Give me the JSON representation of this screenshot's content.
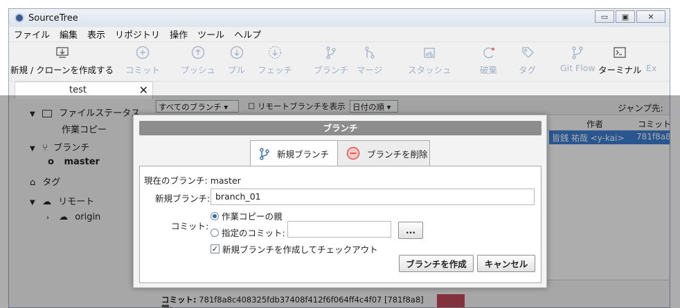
{
  "window": {
    "title": "SourceTree",
    "controls": [
      "▭",
      "▣",
      "✕"
    ]
  },
  "menu": [
    "ファイル",
    "編集",
    "表示",
    "リポジトリ",
    "操作",
    "ツール",
    "ヘルプ"
  ],
  "toolbar": {
    "items": [
      {
        "label": "新規 / クローンを作成する",
        "icon": "computer-download-icon",
        "enabled": true
      },
      {
        "label": "コミット",
        "icon": "plus-circle-icon",
        "enabled": false
      },
      {
        "label": "プッシュ",
        "icon": "arrow-up-circle-icon",
        "enabled": false
      },
      {
        "label": "プル",
        "icon": "arrow-down-circle-icon",
        "enabled": false
      },
      {
        "label": "フェッチ",
        "icon": "arrow-down-dashed-circle-icon",
        "enabled": false
      },
      {
        "label": "ブランチ",
        "icon": "branch-icon",
        "enabled": false
      },
      {
        "label": "マージ",
        "icon": "merge-icon",
        "enabled": false
      },
      {
        "label": "スタッシュ",
        "icon": "stash-icon",
        "enabled": false
      },
      {
        "label": "破棄",
        "icon": "discard-icon",
        "enabled": false
      },
      {
        "label": "タグ",
        "icon": "tag-icon",
        "enabled": false
      },
      {
        "label": "Git Flow",
        "icon": "git-flow-icon",
        "enabled": false
      },
      {
        "label": "ターミナル",
        "icon": "terminal-icon",
        "enabled": true
      },
      {
        "label": "Ex",
        "icon": "",
        "enabled": false
      }
    ]
  },
  "tab": {
    "label": "test",
    "close": "✕"
  },
  "sidebar": {
    "file_status": "ファイルステータス",
    "working_copy": "作業コピー",
    "branches": "ブランチ",
    "branch_master": "master",
    "tags": "タグ",
    "remotes": "リモート",
    "remote_origin": "origin"
  },
  "log_controls": {
    "branch_filter": "すべてのブランチ ▾",
    "show_remote": "リモートブランチを表示",
    "sort": "日付の順 ▾",
    "jump": "ジャンプ先:"
  },
  "columns": {
    "author": "作者",
    "commit": "コミット"
  },
  "selected_row": {
    "author": "皆銭 祐哉 <y-kai>",
    "commit": "781f8a8"
  },
  "details": {
    "commit_label": "コミット:",
    "commit_value": "781f8a8c408325fdb37408f412f6f064ff4c4f07 [781f8a8]",
    "parent_label": "親:"
  },
  "dialog": {
    "title": "ブランチ",
    "tab_new": "新規ブランチ",
    "tab_delete": "ブランチを削除",
    "current_branch_label": "現在のブランチ:",
    "current_branch_value": "master",
    "new_branch_label": "新規ブランチ:",
    "new_branch_value": "branch_01",
    "commit_label": "コミット:",
    "radio_parent": "作業コピーの親",
    "radio_specified": "指定のコミット:",
    "specified_commit_value": "",
    "browse_button": "...",
    "checkout_label": "新規ブランチを作成してチェックアウト",
    "checkout_checked": true,
    "create_button": "ブランチを作成",
    "cancel_button": "キャンセル"
  },
  "colors": {
    "selection": "#3d7fd6",
    "disabled_icon": "#9fb2c7",
    "dialog_title_bg": "#8d8d8d",
    "delete_icon": "#e0504a"
  }
}
